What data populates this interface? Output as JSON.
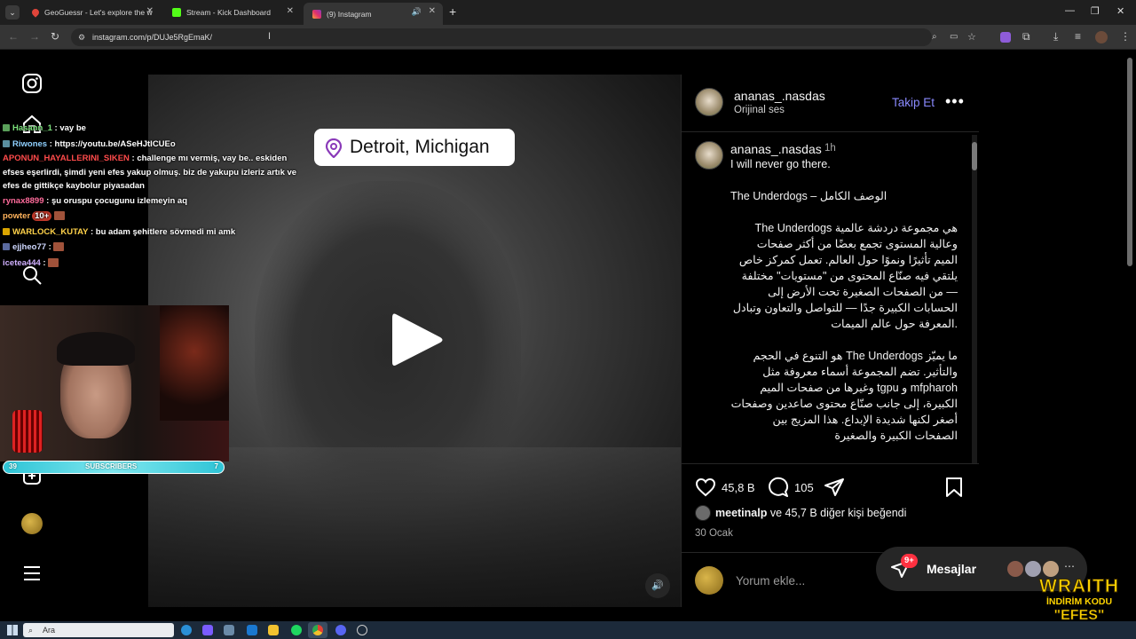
{
  "browser": {
    "tabs": [
      {
        "title": "GeoGuessr - Let's explore the w",
        "active": false
      },
      {
        "title": "Stream - Kick Dashboard",
        "active": false
      },
      {
        "title": "(9) Instagram",
        "active": true
      }
    ],
    "url": "instagram.com/p/DUJe5RgEmaK/"
  },
  "chat": [
    {
      "user": "Hasann_1",
      "msg": "vay be",
      "color": "#7be07b"
    },
    {
      "user": "Riwones",
      "msg": "https://youtu.be/ASeHJtICUEo",
      "color": "#8fd0ff"
    },
    {
      "user": "APONUN_HAYALLERINI_SIKEN",
      "msg": "challenge mı vermiş, vay be.. eskiden efses eşerlirdi, şimdi yeni efes yakup olmuş. biz de yakupu izleriz artık ve efes de gittikçe kaybolur piyasadan",
      "color": "#ff4b4b"
    },
    {
      "user": "rynax8899",
      "msg": "şu oruspu çocugunu izlemeyin aq",
      "color": "#ff6b9b"
    },
    {
      "user": "powter",
      "msg": "10+",
      "color": "#ffb35c"
    },
    {
      "user": "WARLOCK_KUTAY",
      "msg": "bu adam şehitlere sövmedi mi amk",
      "color": "#ffd24a"
    },
    {
      "user": "ejjheo77",
      "msg": "",
      "color": "#cfd8ff"
    },
    {
      "user": "icetea444",
      "msg": "",
      "color": "#d0b0ff"
    }
  ],
  "subscribers": {
    "label": "SUBSCRIBERS",
    "left": "39",
    "right": "7"
  },
  "video": {
    "location": "Detroit, Michigan"
  },
  "post": {
    "username": "ananas_.nasdas",
    "audio": "Orijinal ses",
    "follow": "Takip Et",
    "comment_user": "ananas_.nasdas",
    "comment_time": "1h",
    "desc_lines": [
      "I will never go there.",
      "",
      "The Underdogs – الوصف الكامل",
      "",
      "The Underdogs هي مجموعة دردشة عالمية وعالية المستوى تجمع بعضًا من أكثر صفحات الميم تأثيرًا ونموًا حول العالم. تعمل كمركز خاص يلتقي فيه صنّاع المحتوى من \"مستويات\" مختلفة — من الصفحات الصغيرة تحت الأرض إلى الحسابات الكبيرة جدًا — للتواصل والتعاون وتبادل المعرفة حول عالم الميمات.",
      "",
      "ما يميّز The Underdogs هو التنوع في الحجم والتأثير. تضم المجموعة أسماء معروفة مثل mfpharoh و tgpu وغيرها من صفحات الميم الكبيرة، إلى جانب صنّاع محتوى صاعدين وصفحات أصغر لكنها شديدة الإبداع. هذا المزيج بين الصفحات الكبيرة والصغيرة"
    ],
    "likes": "45,8 B",
    "comments": "105",
    "liked_by_user": "meetinalp",
    "liked_by_rest": "ve 45,7 B diğer kişi beğendi",
    "date": "30 Ocak",
    "comment_placeholder": "Yorum ekle..."
  },
  "messages": {
    "label": "Mesajlar",
    "badge": "9+"
  },
  "overlay": {
    "brand": "WRAITH",
    "line2": "İNDİRİM KODU",
    "line3": "\"EFES\""
  },
  "taskbar": {
    "search": "Ara"
  }
}
